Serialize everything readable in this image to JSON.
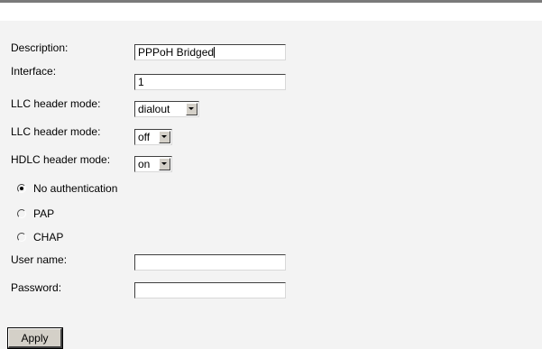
{
  "form": {
    "description": {
      "label": "Description:",
      "value": "PPPoH Bridged"
    },
    "interface": {
      "label": "Interface:",
      "value": "1"
    },
    "llc_mode": {
      "label": "LLC header mode:",
      "selected": "dialout"
    },
    "llc_mode_2": {
      "label": "LLC header mode:",
      "selected": "off"
    },
    "hdlc_mode": {
      "label": "HDLC header mode:",
      "selected": "on"
    },
    "auth": {
      "options": [
        {
          "label": "No authentication",
          "checked": true
        },
        {
          "label": "PAP",
          "checked": false
        },
        {
          "label": "CHAP",
          "checked": false
        }
      ]
    },
    "username": {
      "label": "User name:",
      "value": ""
    },
    "password": {
      "label": "Password:",
      "value": ""
    },
    "apply_label": "Apply"
  },
  "icons": {
    "dropdown": "chevron-down-icon",
    "radio": "radio-button-icon"
  }
}
